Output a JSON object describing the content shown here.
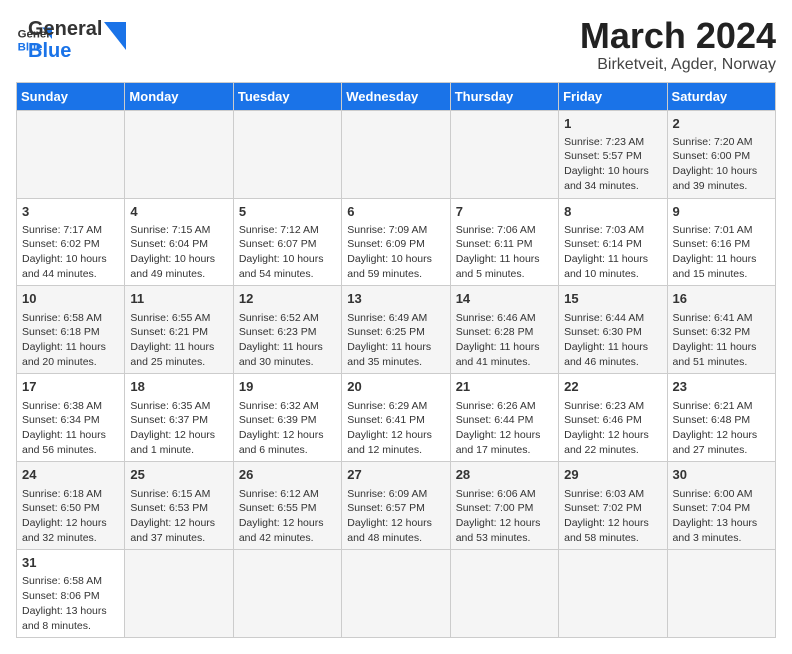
{
  "header": {
    "logo_general": "General",
    "logo_blue": "Blue",
    "title": "March 2024",
    "subtitle": "Birketveit, Agder, Norway"
  },
  "days_of_week": [
    "Sunday",
    "Monday",
    "Tuesday",
    "Wednesday",
    "Thursday",
    "Friday",
    "Saturday"
  ],
  "weeks": [
    [
      {
        "day": "",
        "info": ""
      },
      {
        "day": "",
        "info": ""
      },
      {
        "day": "",
        "info": ""
      },
      {
        "day": "",
        "info": ""
      },
      {
        "day": "",
        "info": ""
      },
      {
        "day": "1",
        "info": "Sunrise: 7:23 AM\nSunset: 5:57 PM\nDaylight: 10 hours and 34 minutes."
      },
      {
        "day": "2",
        "info": "Sunrise: 7:20 AM\nSunset: 6:00 PM\nDaylight: 10 hours and 39 minutes."
      }
    ],
    [
      {
        "day": "3",
        "info": "Sunrise: 7:17 AM\nSunset: 6:02 PM\nDaylight: 10 hours and 44 minutes."
      },
      {
        "day": "4",
        "info": "Sunrise: 7:15 AM\nSunset: 6:04 PM\nDaylight: 10 hours and 49 minutes."
      },
      {
        "day": "5",
        "info": "Sunrise: 7:12 AM\nSunset: 6:07 PM\nDaylight: 10 hours and 54 minutes."
      },
      {
        "day": "6",
        "info": "Sunrise: 7:09 AM\nSunset: 6:09 PM\nDaylight: 10 hours and 59 minutes."
      },
      {
        "day": "7",
        "info": "Sunrise: 7:06 AM\nSunset: 6:11 PM\nDaylight: 11 hours and 5 minutes."
      },
      {
        "day": "8",
        "info": "Sunrise: 7:03 AM\nSunset: 6:14 PM\nDaylight: 11 hours and 10 minutes."
      },
      {
        "day": "9",
        "info": "Sunrise: 7:01 AM\nSunset: 6:16 PM\nDaylight: 11 hours and 15 minutes."
      }
    ],
    [
      {
        "day": "10",
        "info": "Sunrise: 6:58 AM\nSunset: 6:18 PM\nDaylight: 11 hours and 20 minutes."
      },
      {
        "day": "11",
        "info": "Sunrise: 6:55 AM\nSunset: 6:21 PM\nDaylight: 11 hours and 25 minutes."
      },
      {
        "day": "12",
        "info": "Sunrise: 6:52 AM\nSunset: 6:23 PM\nDaylight: 11 hours and 30 minutes."
      },
      {
        "day": "13",
        "info": "Sunrise: 6:49 AM\nSunset: 6:25 PM\nDaylight: 11 hours and 35 minutes."
      },
      {
        "day": "14",
        "info": "Sunrise: 6:46 AM\nSunset: 6:28 PM\nDaylight: 11 hours and 41 minutes."
      },
      {
        "day": "15",
        "info": "Sunrise: 6:44 AM\nSunset: 6:30 PM\nDaylight: 11 hours and 46 minutes."
      },
      {
        "day": "16",
        "info": "Sunrise: 6:41 AM\nSunset: 6:32 PM\nDaylight: 11 hours and 51 minutes."
      }
    ],
    [
      {
        "day": "17",
        "info": "Sunrise: 6:38 AM\nSunset: 6:34 PM\nDaylight: 11 hours and 56 minutes."
      },
      {
        "day": "18",
        "info": "Sunrise: 6:35 AM\nSunset: 6:37 PM\nDaylight: 12 hours and 1 minute."
      },
      {
        "day": "19",
        "info": "Sunrise: 6:32 AM\nSunset: 6:39 PM\nDaylight: 12 hours and 6 minutes."
      },
      {
        "day": "20",
        "info": "Sunrise: 6:29 AM\nSunset: 6:41 PM\nDaylight: 12 hours and 12 minutes."
      },
      {
        "day": "21",
        "info": "Sunrise: 6:26 AM\nSunset: 6:44 PM\nDaylight: 12 hours and 17 minutes."
      },
      {
        "day": "22",
        "info": "Sunrise: 6:23 AM\nSunset: 6:46 PM\nDaylight: 12 hours and 22 minutes."
      },
      {
        "day": "23",
        "info": "Sunrise: 6:21 AM\nSunset: 6:48 PM\nDaylight: 12 hours and 27 minutes."
      }
    ],
    [
      {
        "day": "24",
        "info": "Sunrise: 6:18 AM\nSunset: 6:50 PM\nDaylight: 12 hours and 32 minutes."
      },
      {
        "day": "25",
        "info": "Sunrise: 6:15 AM\nSunset: 6:53 PM\nDaylight: 12 hours and 37 minutes."
      },
      {
        "day": "26",
        "info": "Sunrise: 6:12 AM\nSunset: 6:55 PM\nDaylight: 12 hours and 42 minutes."
      },
      {
        "day": "27",
        "info": "Sunrise: 6:09 AM\nSunset: 6:57 PM\nDaylight: 12 hours and 48 minutes."
      },
      {
        "day": "28",
        "info": "Sunrise: 6:06 AM\nSunset: 7:00 PM\nDaylight: 12 hours and 53 minutes."
      },
      {
        "day": "29",
        "info": "Sunrise: 6:03 AM\nSunset: 7:02 PM\nDaylight: 12 hours and 58 minutes."
      },
      {
        "day": "30",
        "info": "Sunrise: 6:00 AM\nSunset: 7:04 PM\nDaylight: 13 hours and 3 minutes."
      }
    ],
    [
      {
        "day": "31",
        "info": "Sunrise: 6:58 AM\nSunset: 8:06 PM\nDaylight: 13 hours and 8 minutes."
      },
      {
        "day": "",
        "info": ""
      },
      {
        "day": "",
        "info": ""
      },
      {
        "day": "",
        "info": ""
      },
      {
        "day": "",
        "info": ""
      },
      {
        "day": "",
        "info": ""
      },
      {
        "day": "",
        "info": ""
      }
    ]
  ]
}
